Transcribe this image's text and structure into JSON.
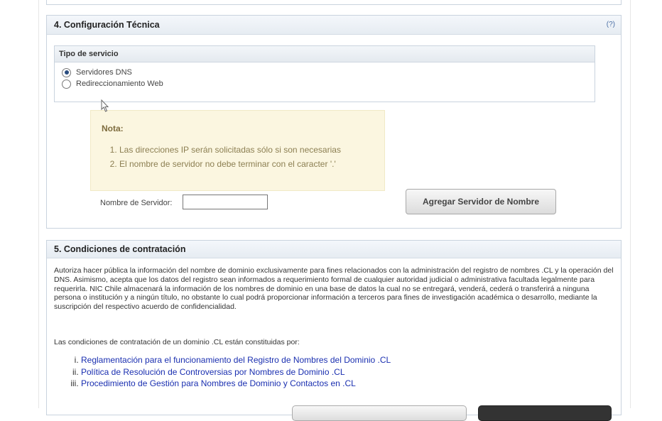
{
  "section4": {
    "title": "4. Configuración Técnica",
    "help": "(?)",
    "service_type": {
      "header": "Tipo de servicio",
      "options": [
        {
          "label": "Servidores DNS",
          "selected": true
        },
        {
          "label": "Redireccionamiento Web",
          "selected": false
        }
      ]
    },
    "note": {
      "title": "Nota:",
      "items": [
        "Las direcciones IP serán solicitadas sólo si son necesarias",
        "El nombre de servidor no debe terminar con el caracter '.'"
      ]
    },
    "server_name_label": "Nombre de Servidor:",
    "server_name_value": "",
    "add_button": "Agregar Servidor de Nombre"
  },
  "section5": {
    "title": "5. Condiciones de contratación",
    "paragraph": "Autoriza hacer pública la información del nombre de dominio exclusivamente para fines relacionados con la administración del registro de nombres .CL y la operación del DNS. Asimismo, acepta que los datos del registro sean informados a requerimiento formal de cualquier autoridad judicial o administrativa facultada legalmente para requerirla. NIC Chile almacenará la información de los nombres de dominio en una base de datos la cual no se entregará, venderá, cederá o transferirá a ninguna persona o institución y a ningún título, no obstante lo cual podrá proporcionar información a terceros para fines de investigación académica o desarrollo, mediante la suscripción del respectivo acuerdo de confidencialidad.",
    "intro": "Las condiciones de contratación de un dominio .CL están constituidas por:",
    "links": [
      "Reglamentación para el funcionamiento del Registro de Nombres del Dominio .CL",
      "Política de Resolución de Controversias por Nombres de Dominio .CL",
      "Procedimiento de Gestión para Nombres de Dominio y Contactos en .CL"
    ]
  },
  "colors": {
    "accent": "#2a4d7f",
    "link": "#1a2fb0",
    "note_bg": "#fbf6e0"
  }
}
